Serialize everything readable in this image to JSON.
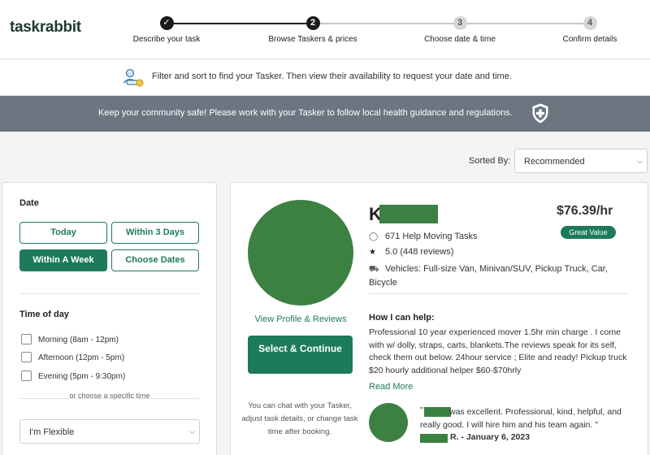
{
  "header": {
    "logo": "taskrabbit",
    "steps": [
      {
        "num": "✓",
        "label": "Describe your task",
        "state": "done"
      },
      {
        "num": "2",
        "label": "Browse Taskers & prices",
        "state": "active"
      },
      {
        "num": "3",
        "label": "Choose date & time",
        "state": "todo"
      },
      {
        "num": "4",
        "label": "Confirm details",
        "state": "todo"
      }
    ]
  },
  "info": {
    "text": "Filter and sort to find your Tasker. Then view their availability to request your date and time.",
    "icon": "people-filter-icon"
  },
  "safety": {
    "text": "Keep your community safe! Please work with your Tasker to follow local health guidance and regulations.",
    "icon": "shield-cross-icon"
  },
  "sort": {
    "label": "Sorted By:",
    "value": "Recommended"
  },
  "filters": {
    "date_title": "Date",
    "date_options": [
      {
        "label": "Today",
        "active": false
      },
      {
        "label": "Within 3 Days",
        "active": false
      },
      {
        "label": "Within A Week",
        "active": true
      },
      {
        "label": "Choose Dates",
        "active": false
      }
    ],
    "time_title": "Time of day",
    "time_options": [
      {
        "label": "Morning (8am - 12pm)",
        "checked": false
      },
      {
        "label": "Afternoon (12pm - 5pm)",
        "checked": false
      },
      {
        "label": "Evening (5pm - 9:30pm)",
        "checked": false
      }
    ],
    "or_specific": "or choose a specific time",
    "time_select": "I'm Flexible"
  },
  "tasker": {
    "name_initial": "K",
    "rate": "$76.39/hr",
    "badge": "Great Value",
    "tasks": "671 Help Moving Tasks",
    "rating": "5.0 (448 reviews)",
    "vehicles": "Vehicles: Full-size Van, Minivan/SUV, Pickup Truck, Car, Bicycle",
    "view_profile": "View Profile & Reviews",
    "select_button": "Select & Continue",
    "chat_note": "You can chat with your Tasker, adjust task details, or change task time after booking.",
    "help_title": "How I can help:",
    "help_body": "Professional 10 year experienced mover 1.5hr min charge . I come with w/ dolly, straps, carts, blankets.The reviews speak for its self, check them out below. 24hour service ; Elite and ready! Pickup truck $20 hourly additional helper $60-$70hrly",
    "read_more": "Read More",
    "review_text": "was excellent. Professional, kind, helpful, and really good. I will hire him and his team again. \"",
    "review_author": "R. - January 6, 2023",
    "review_open_quote": "\""
  },
  "colors": {
    "brand_green": "#1e7a5c",
    "redaction_green": "#3c8042",
    "banner_gray": "#6c7681"
  }
}
